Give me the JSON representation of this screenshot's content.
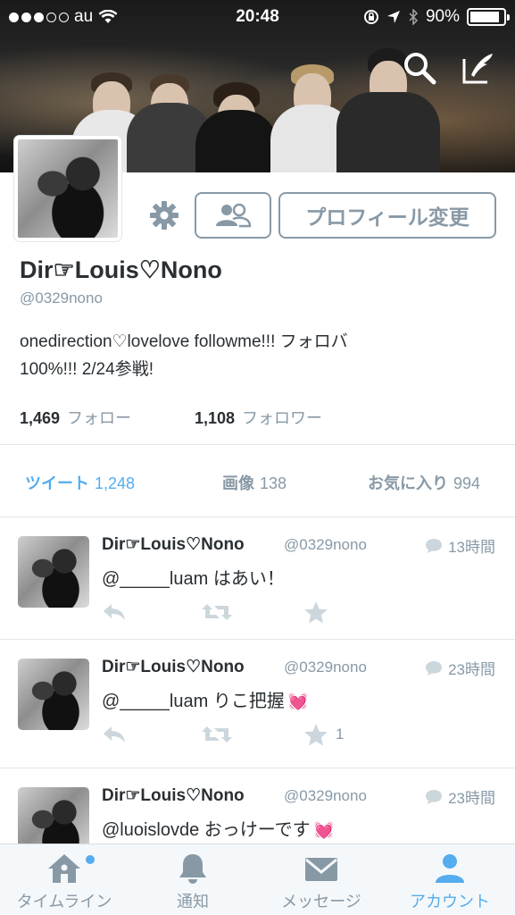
{
  "status_bar": {
    "carrier": "au",
    "time": "20:48",
    "battery": "90%",
    "battery_level": 0.9,
    "icons": [
      "signal-dots-icon",
      "wifi-icon",
      "rotation-lock-icon",
      "location-arrow-icon",
      "bluetooth-icon",
      "battery-icon"
    ]
  },
  "header": {
    "search_icon": "search-icon",
    "compose_icon": "compose-tweet-icon"
  },
  "profile": {
    "name": "Dir☞Louis♡Nono",
    "handle": "@0329nono",
    "bio_line1": "onedirection♡lovelove followme!!! フォロバ",
    "bio_line2": "100%!!! 2/24参戦!",
    "edit_button": "プロフィール変更",
    "following_count": "1,469",
    "following_label": "フォロー",
    "followers_count": "1,108",
    "followers_label": "フォロワー"
  },
  "tabs": [
    {
      "label": "ツイート",
      "count": "1,248",
      "active": true
    },
    {
      "label": "画像",
      "count": "138",
      "active": false
    },
    {
      "label": "お気に入り",
      "count": "994",
      "active": false
    }
  ],
  "tweets": [
    {
      "name": "Dir☞Louis♡Nono",
      "handle": "@0329nono",
      "time": "13時間",
      "text": "@_____luam はあい！",
      "heart": "",
      "favorite_count": ""
    },
    {
      "name": "Dir☞Louis♡Nono",
      "handle": "@0329nono",
      "time": "23時間",
      "text": "@_____luam りこ把握",
      "heart": "💓",
      "favorite_count": "1"
    },
    {
      "name": "Dir☞Louis♡Nono",
      "handle": "@0329nono",
      "time": "23時間",
      "text": "@luoislovde おっけーです",
      "heart": "💓",
      "favorite_count": ""
    }
  ],
  "tabbar": [
    {
      "label": "タイムライン",
      "icon": "home-icon",
      "active": false
    },
    {
      "label": "通知",
      "icon": "bell-icon",
      "active": false
    },
    {
      "label": "メッセージ",
      "icon": "envelope-icon",
      "active": false
    },
    {
      "label": "アカウント",
      "icon": "person-icon",
      "active": true
    }
  ],
  "colors": {
    "accent": "#55acee",
    "gray": "#8899a6",
    "text": "#292f33",
    "divider": "#e1e8ed"
  }
}
